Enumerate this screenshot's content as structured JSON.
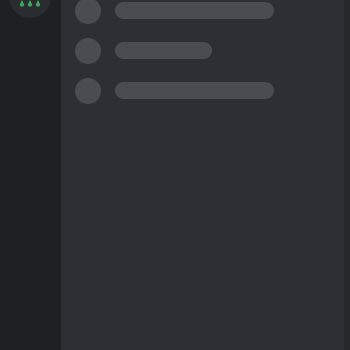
{
  "theme": {
    "rail_background": "#1f2024",
    "panel_background": "#2e2f34",
    "skeleton_color": "#4a4c52",
    "accent": "#3ba55c"
  },
  "server_rail": {
    "icon": "server-status-icon"
  },
  "loading_list": {
    "state": "loading",
    "placeholder_rows": 3
  }
}
